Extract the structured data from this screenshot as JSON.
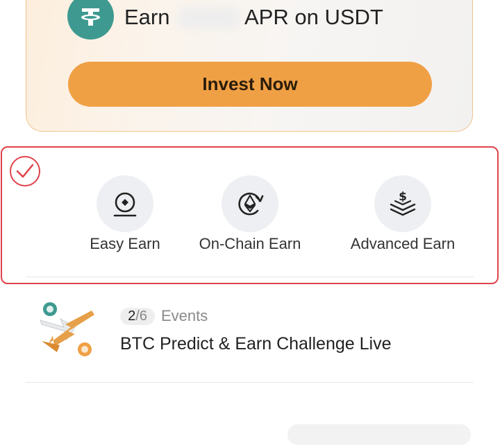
{
  "promo": {
    "earn_label": "Earn",
    "apr_label": "APR on USDT",
    "invest_button": "Invest Now",
    "logo_icon": "tether-usdt-icon",
    "button_color": "#f0a044"
  },
  "earn_options": [
    {
      "label": "Easy Earn",
      "icon": "easy-earn-icon"
    },
    {
      "label": "On-Chain Earn",
      "icon": "ethereum-cycle-icon"
    },
    {
      "label": "Advanced Earn",
      "icon": "layered-dollar-icon"
    }
  ],
  "highlight": {
    "color": "#e0424a",
    "icon": "checkmark-icon"
  },
  "event": {
    "current": "2",
    "separator": "/",
    "total": "6",
    "category": "Events",
    "title": "BTC Predict & Earn Challenge Live",
    "illustration_icon": "btc-arrows-illustration"
  }
}
